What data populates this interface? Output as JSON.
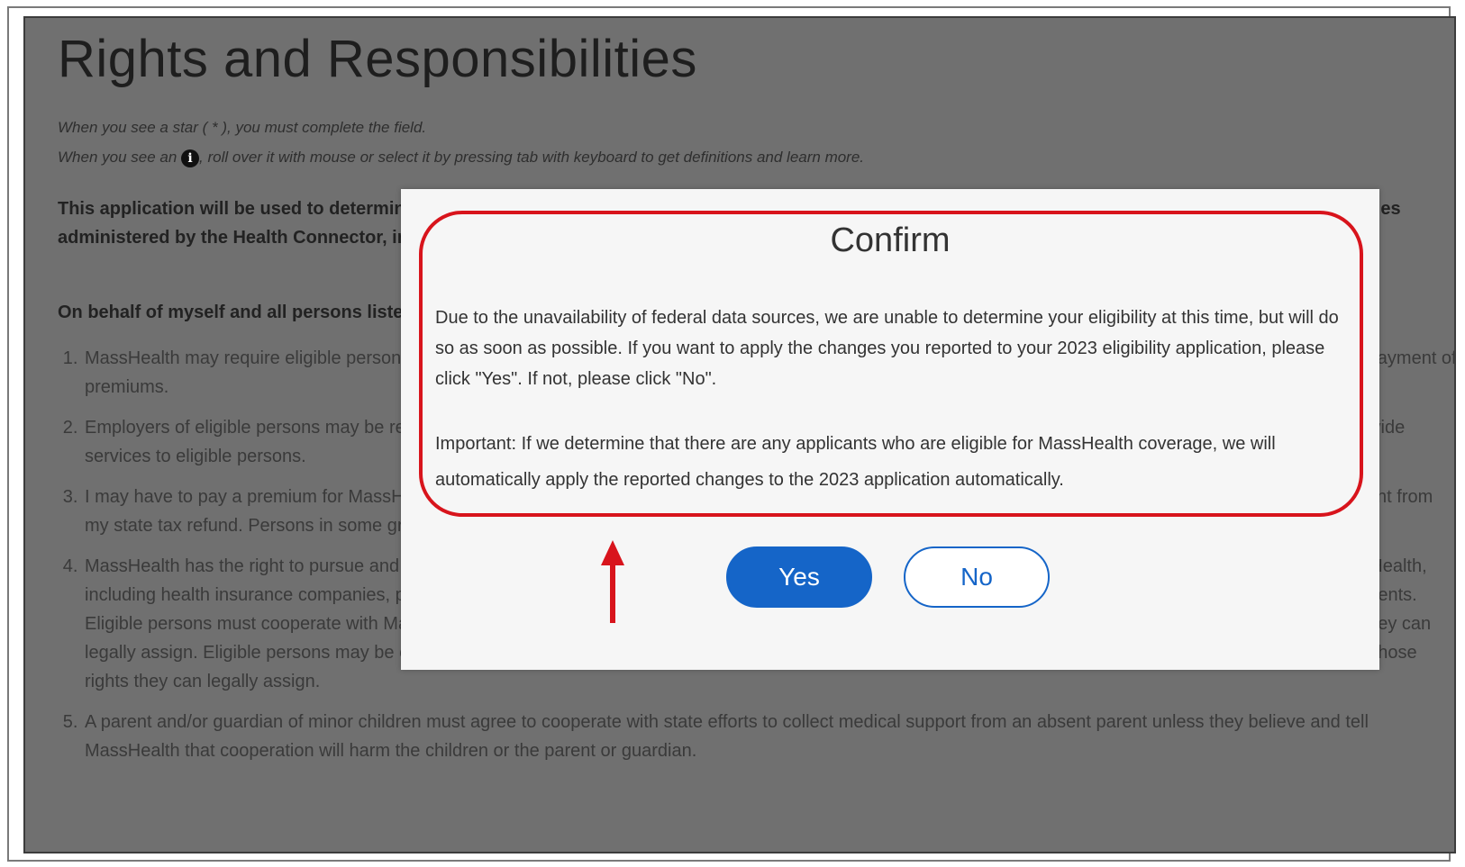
{
  "page": {
    "title": "Rights and Responsibilities",
    "hint_star": "When you see a star ( * ), you must complete the field.",
    "hint_info_before": "When you see an",
    "hint_info_icon": "i",
    "hint_info_after": ", roll over it with mouse or select it by pressing tab with keyboard to get definitions and learn more.",
    "intro": "This application will be used to determine eligibility for MassHealth, the Health Safety Net, the Children's Medical Security Plan, and state premium subsidies administered by the Health Connector, including coverage for Health Connector plans and eligibility for Health Safety Net.",
    "behalf": "On behalf of myself and all persons listed on this application, I understand and agree to the following:",
    "items": [
      "MassHealth may require eligible persons to enroll in health insurance that is available to them. Their failure to do so may result in losing eligibility for MassHealth payment of premiums.",
      "Employers of eligible persons may be required to pay for health insurance premiums. Health care providers, including hospitals and community health centers provide services to eligible persons.",
      "I may have to pay a premium for MassHealth coverage. If I do not pay these premiums, I may lose my coverage, and it may result in the State deducting the amount from my state tax refund. Persons in some groups, such as American Indians and Alaska Natives, may not have to pay premiums for MassHealth.",
      "MassHealth has the right to pursue and recover payments from other parties who are responsible for payment of medical bills of eligible persons enrolled in MassHealth, including health insurance companies, people who have been ordered by a court to provide medical support, or individuals obligated to pay under accident settlements. Eligible persons must cooperate with MassHealth in establishing third party support and obtaining third-party payments for themselves and anyone whose rights they can legally assign. Eligible persons may be exempted from this obligation if they believe and tell MassHealth that cooperation could result in harm to them or anyone whose rights they can legally assign.",
      "A parent and/or guardian of minor children must agree to cooperate with state efforts to collect medical support from an absent parent unless they believe and tell MassHealth that cooperation will harm the children or the parent or guardian."
    ]
  },
  "modal": {
    "title": "Confirm",
    "message": "Due to the unavailability of federal data sources, we are unable to determine your eligibility at this time, but will do so as soon as possible.  If you want to apply the changes you reported to your 2023 eligibility application, please click \"Yes\".  If not, please click \"No\".",
    "important": "Important:  If we determine that there are any applicants who are eligible for MassHealth coverage, we will automatically apply the reported changes to the 2023 application automatically.",
    "yes_label": "Yes",
    "no_label": "No"
  },
  "colors": {
    "highlight": "#d8141c",
    "primary_button": "#1565c8",
    "overlay": "#707070"
  },
  "icons": {
    "info": "info-icon",
    "annotation": "arrow-up-icon"
  }
}
